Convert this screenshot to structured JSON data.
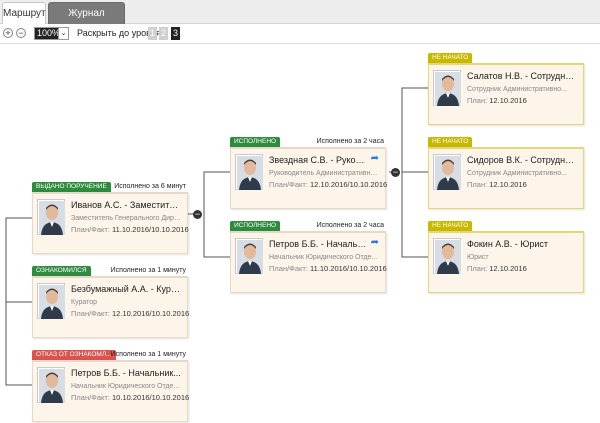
{
  "tabs": [
    {
      "label": "Маршрут",
      "active": true
    },
    {
      "label": "Журнал движения",
      "active": false
    }
  ],
  "toolbar": {
    "zoom_in_icon": "+",
    "zoom_out_icon": "−",
    "zoom_value": "100%",
    "dropdown_icon": "⌄",
    "expand_label": "Раскрыть до уровня",
    "levels": [
      "1",
      "2",
      "3"
    ],
    "active_level": "3"
  },
  "colors": {
    "issued": "#2e8b3e",
    "done": "#2e8b3e",
    "acknowledged": "#2e8b3e",
    "rejected": "#d9534f",
    "not_started": "#c9b800"
  },
  "cards": [
    {
      "key": "ivanov",
      "badge": "ВЫДАНО ПОРУЧЕНИЕ",
      "badge_color": "#2e8b3e",
      "done_time": "Исполнено за 6 минут",
      "name": "Иванов А.С. - Заместител...",
      "role": "Заместитель Генерального Дире...",
      "dates_label": "План/Факт:",
      "dates_value": "11.10.2016/10.10.2016"
    },
    {
      "key": "bezumazhny",
      "badge": "ОЗНАКОМИЛСЯ",
      "badge_color": "#2e8b3e",
      "done_time": "Исполнено за 1 минуту",
      "name": "Безбумажный А.А. - Кура...",
      "role": "Куратор",
      "dates_label": "План/Факт:",
      "dates_value": "12.10.2016/10.10.2016"
    },
    {
      "key": "petrov-rejected",
      "badge": "ОТКАЗ ОТ ОЗНАКОМЛ...",
      "badge_color": "#d9534f",
      "done_time": "Исполнено за 1 минуту",
      "name": "Петров Б.Б. - Начальник...",
      "role": "Начальник Юридического Отдела",
      "dates_label": "План/Факт:",
      "dates_value": "10.10.2016/10.10.2016"
    },
    {
      "key": "zvezdnaya",
      "badge": "ИСПОЛНЕНО",
      "badge_color": "#2e8b3e",
      "done_time": "Исполнено за 2 часа",
      "name": "Звездная С.В. - Руководи...",
      "role": "Руководитель Административно...",
      "dates_label": "План/Факт:",
      "dates_value": "12.10.2016/10.10.2016"
    },
    {
      "key": "petrov-done",
      "badge": "ИСПОЛНЕНО",
      "badge_color": "#2e8b3e",
      "done_time": "Исполнено за 2 часа",
      "name": "Петров Б.Б. - Начальник...",
      "role": "Начальник Юридического Отдела",
      "dates_label": "План/Факт:",
      "dates_value": "11.10.2016/10.10.2016"
    },
    {
      "key": "salatov",
      "badge": "НЕ НАЧАТО",
      "badge_color": "#c9b800",
      "done_time": "",
      "name": "Салатов Н.В. - Сотрудник...",
      "role": "Сотрудник Административно...",
      "dates_label": "План:",
      "dates_value": "12.10.2016"
    },
    {
      "key": "sidorov",
      "badge": "НЕ НАЧАТО",
      "badge_color": "#c9b800",
      "done_time": "",
      "name": "Сидоров В.К. - Сотрудник...",
      "role": "Сотрудник Административно...",
      "dates_label": "План:",
      "dates_value": "12.10.2016"
    },
    {
      "key": "fokin",
      "badge": "НЕ НАЧАТО",
      "badge_color": "#c9b800",
      "done_time": "",
      "name": "Фокин А.В. - Юрист",
      "role": "Юрист",
      "dates_label": "План:",
      "dates_value": "12.10.2016"
    }
  ],
  "toggle_icon": "−",
  "share_icon": "➦"
}
